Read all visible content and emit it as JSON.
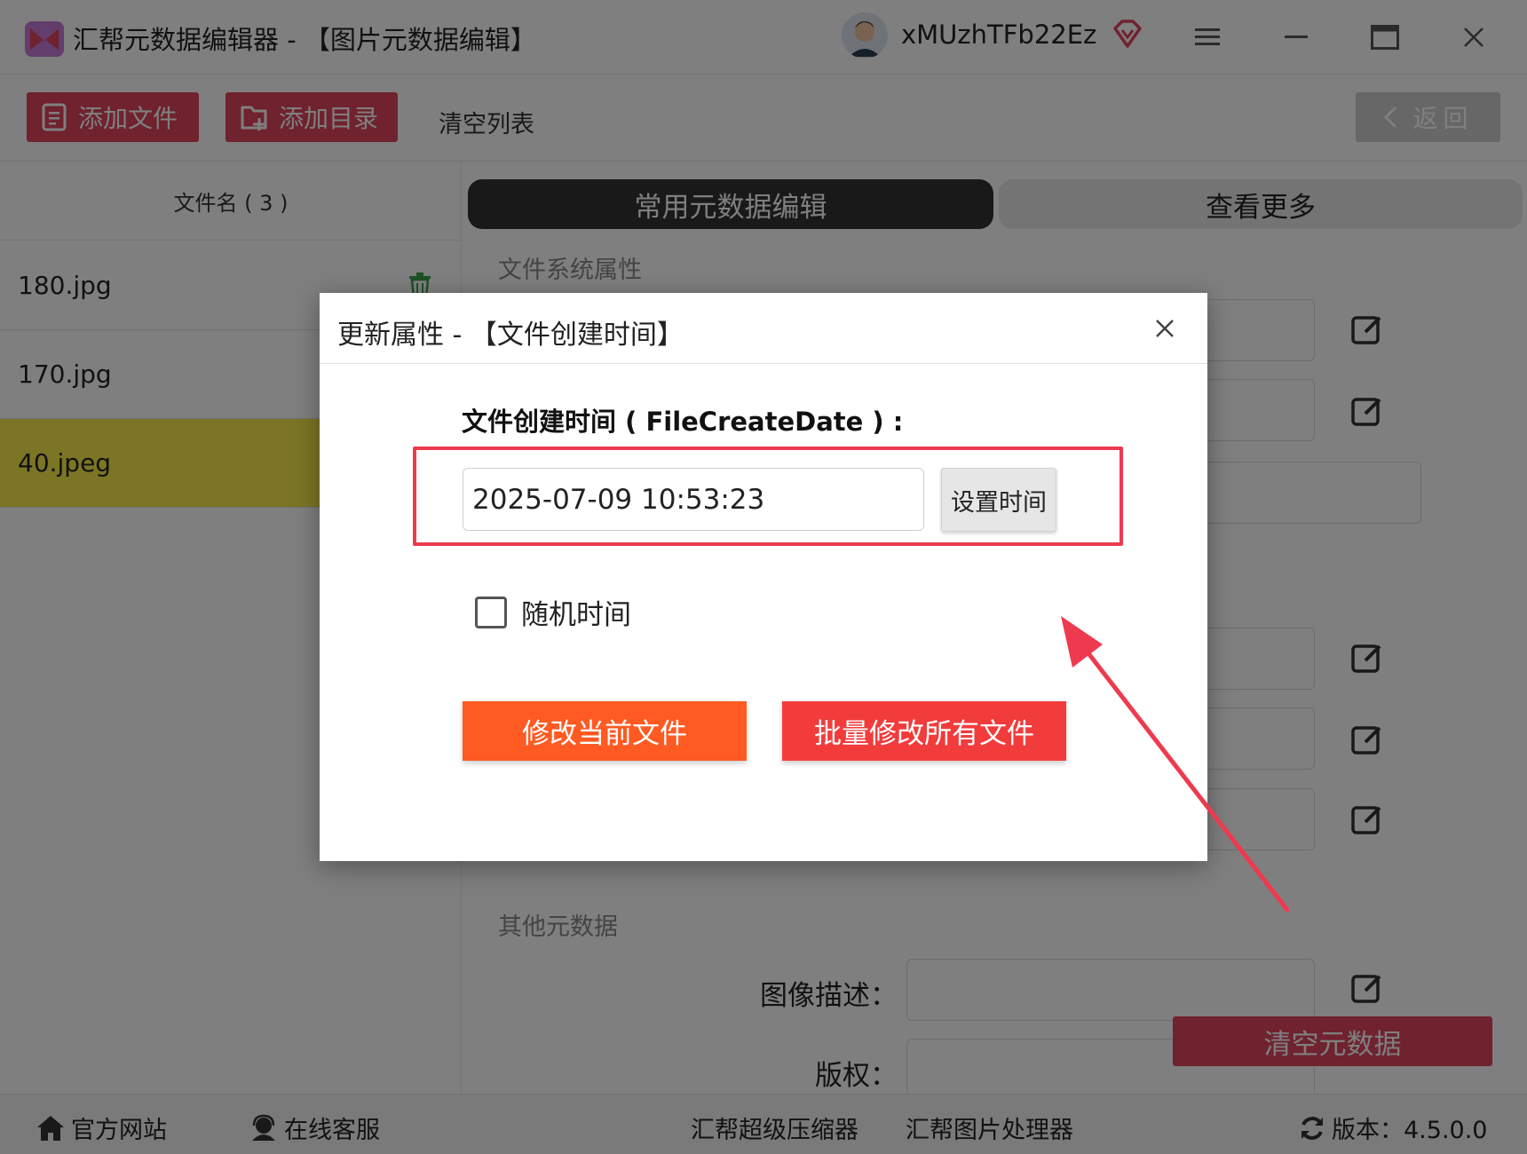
{
  "app": {
    "title": "汇帮元数据编辑器 - 【图片元数据编辑】",
    "username": "xMUzhTFb22Ez"
  },
  "toolbar": {
    "add_file": "添加文件",
    "add_dir": "添加目录",
    "clear_list": "清空列表",
    "back": "返回"
  },
  "file_list": {
    "header": "文件名 ( 3 )",
    "files": [
      {
        "name": "180.jpg"
      },
      {
        "name": "170.jpg"
      },
      {
        "name": "40.jpeg"
      }
    ]
  },
  "tabs": {
    "common": "常用元数据编辑",
    "more": "查看更多"
  },
  "sections": {
    "fs_props": "文件系统属性",
    "other_meta": "其他元数据"
  },
  "fields": {
    "image_desc": "图像描述：",
    "copyright": "版权："
  },
  "clear_meta": "清空元数据",
  "dialog": {
    "title": "更新属性 - 【文件创建时间】",
    "field_label": "文件创建时间 ( FileCreateDate ) :",
    "time_value": "2025-07-09 10:53:23",
    "set_time": "设置时间",
    "random_time": "随机时间",
    "modify_current": "修改当前文件",
    "batch_modify": "批量修改所有文件"
  },
  "footer": {
    "official_site": "官方网站",
    "online_service": "在线客服",
    "compressor": "汇帮超级压缩器",
    "image_processor": "汇帮图片处理器",
    "version": "版本：4.5.0.0"
  },
  "colors": {
    "accent": "#e0445e",
    "selected_row": "#f7eb4b",
    "highlight_border": "#ee3a4f",
    "btn_current": "#ff5a22",
    "btn_batch": "#f23c3c"
  },
  "icons": {
    "logo": "app-logo-icon",
    "vip": "vip-diamond-icon",
    "trash": "trash-icon",
    "edit": "edit-icon",
    "close": "close-icon",
    "home": "home-icon",
    "service": "headset-icon",
    "refresh": "refresh-icon"
  }
}
